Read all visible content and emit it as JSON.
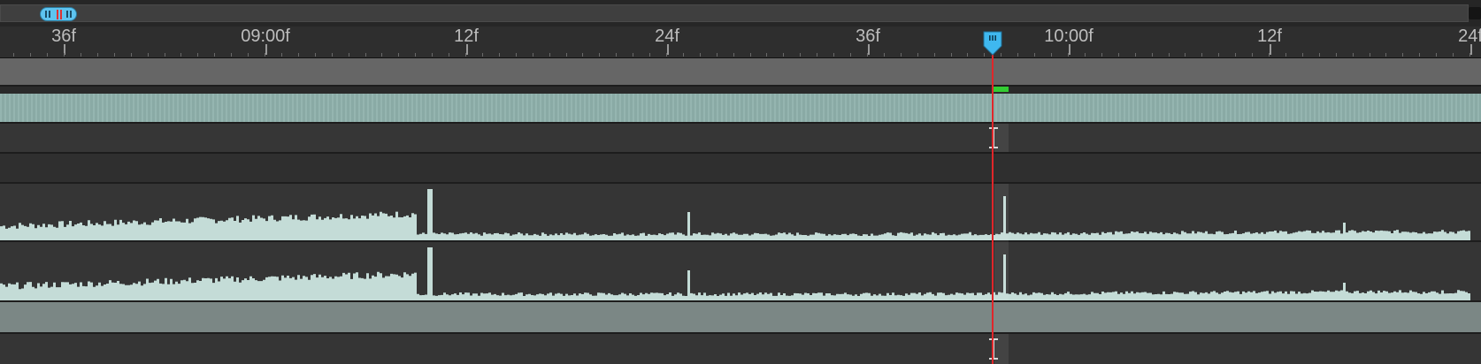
{
  "timeline": {
    "ruler_labels": [
      "36f",
      "09:00f",
      "12f",
      "24f",
      "36f",
      "10:00f",
      "12f",
      "24f"
    ],
    "colors": {
      "playhead": "#e0262a",
      "playhead_head": "#3fb8ef",
      "video_clip": "#8fb1ac",
      "audio_waveform": "#c4dcd7",
      "render_marker": "#33cc33"
    }
  },
  "icons": {
    "nav_thumb": "zoom-scroll-thumb",
    "playhead": "playhead-marker-icon",
    "edit_point": "ibeam-cursor-icon"
  }
}
